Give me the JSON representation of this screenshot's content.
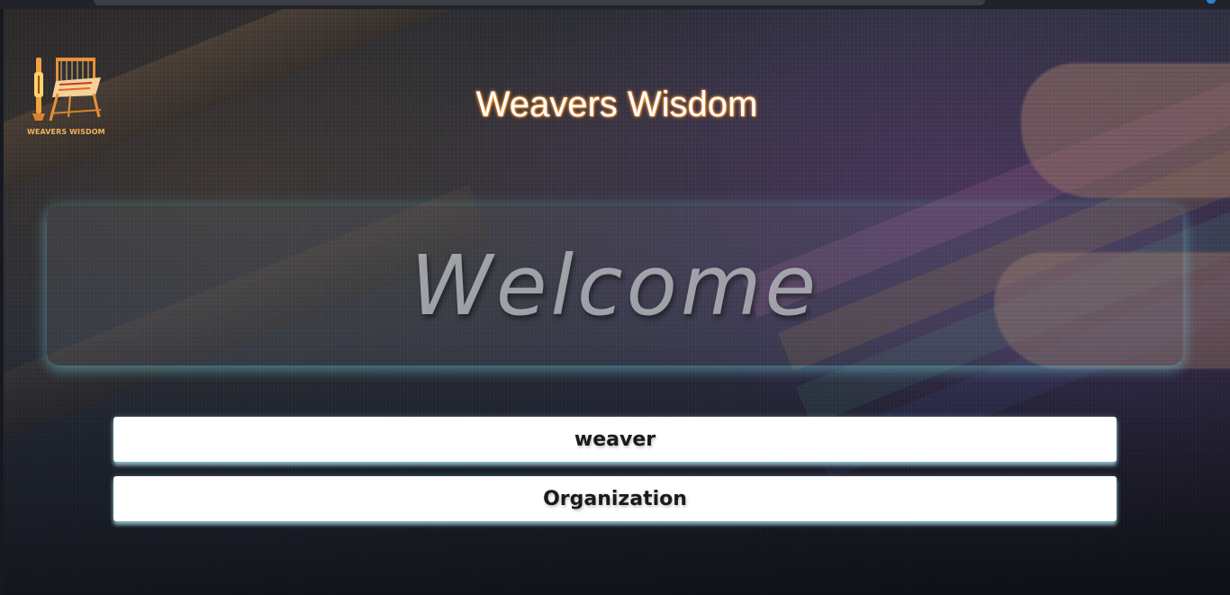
{
  "header": {
    "logo_text": "WEAVERS WISDOM",
    "title": "Weavers Wisdom"
  },
  "hero": {
    "welcome_text": "Welcome"
  },
  "options": [
    {
      "label": "weaver"
    },
    {
      "label": "Organization"
    }
  ],
  "colors": {
    "title_glow": "#ff9a33",
    "logo_accent": "#f0b35c",
    "button_bg": "#ffffff",
    "button_glow": "#aae1eb"
  },
  "icons": {
    "logo": "loom-logo-icon"
  }
}
